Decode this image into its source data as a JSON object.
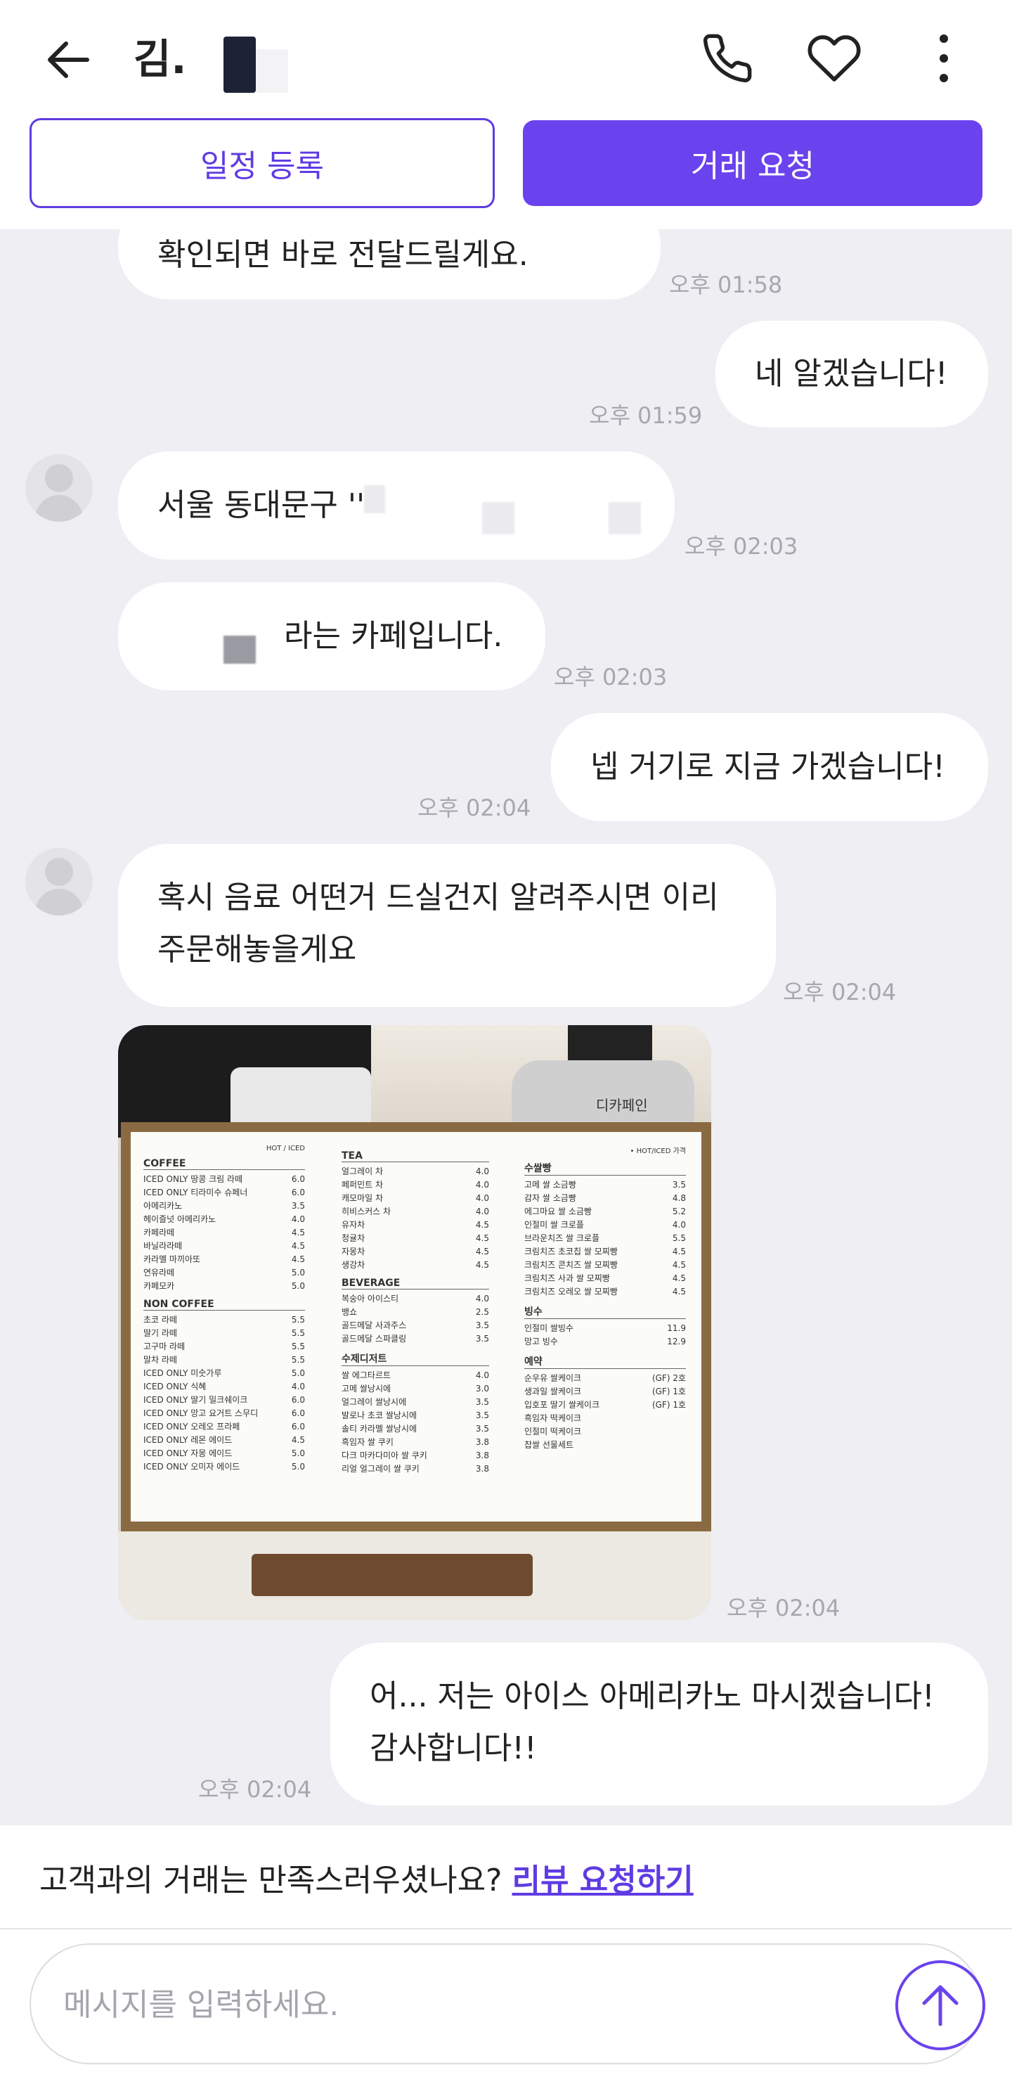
{
  "header": {
    "contact_name": "김.",
    "buttons": {
      "schedule": "일정 등록",
      "trade_request": "거래 요청"
    }
  },
  "messages": [
    {
      "side": "in",
      "lines": [
        "확인되면 바로 전달드릴게요."
      ],
      "time": "오후 01:58"
    },
    {
      "side": "out",
      "lines": [
        "네 알겠습니다!"
      ],
      "time": "오후 01:59"
    },
    {
      "side": "in",
      "lines": [
        "서울 동대문구 '' "
      ],
      "time": "오후 02:03"
    },
    {
      "side": "in",
      "lines": [
        "라는 카페입니다."
      ],
      "time": "오후 02:03"
    },
    {
      "side": "out",
      "lines": [
        "넵 거기로 지금 가겠습니다!"
      ],
      "time": "오후 02:04"
    },
    {
      "side": "in",
      "lines": [
        "혹시 음료 어떤거 드실건지 알려주시면 이리",
        "주문해놓을게요"
      ],
      "time": "오후 02:04"
    },
    {
      "side": "in",
      "type": "image",
      "time": "오후 02:04"
    },
    {
      "side": "out",
      "lines": [
        "어... 저는 아이스 아메리카노 마시겠습니다!",
        "감사합니다!!"
      ],
      "time": "오후 02:04"
    }
  ],
  "photo_menu": {
    "cafe_label": "디카페인",
    "hot_iced": "HOT / ICED",
    "coffee": {
      "title": "COFFEE",
      "items": [
        [
          "ICED ONLY 땅콩 크림 라떼",
          "6.0"
        ],
        [
          "ICED ONLY 티라미수 슈페너",
          "6.0"
        ],
        [
          "아메리카노",
          "3.5"
        ],
        [
          "헤이즐넛 아메리카노",
          "4.0"
        ],
        [
          "카페라떼",
          "4.5"
        ],
        [
          "바닐라라떼",
          "4.5"
        ],
        [
          "카라멜 마끼아또",
          "4.5"
        ],
        [
          "연유라떼",
          "5.0"
        ],
        [
          "카페모카",
          "5.0"
        ]
      ]
    },
    "noncoffee": {
      "title": "NON COFFEE",
      "items": [
        [
          "초코 라떼",
          "5.5"
        ],
        [
          "딸기 라떼",
          "5.5"
        ],
        [
          "고구마 라떼",
          "5.5"
        ],
        [
          "말차 라떼",
          "5.5"
        ],
        [
          "ICED ONLY 미숫가루",
          "5.0"
        ],
        [
          "ICED ONLY 식혜",
          "4.0"
        ],
        [
          "ICED ONLY 딸기 밀크쉐이크",
          "6.0"
        ],
        [
          "ICED ONLY 망고 요거트 스무디",
          "6.0"
        ],
        [
          "ICED ONLY 오레오 프라페",
          "6.0"
        ],
        [
          "ICED ONLY 레몬 에이드",
          "4.5"
        ],
        [
          "ICED ONLY 자몽 에이드",
          "5.0"
        ],
        [
          "ICED ONLY 오미자 에이드",
          "5.0"
        ]
      ]
    },
    "tea": {
      "title": "TEA",
      "items": [
        [
          "얼그레이 차",
          "4.0"
        ],
        [
          "페퍼민트 차",
          "4.0"
        ],
        [
          "캐모마일 차",
          "4.0"
        ],
        [
          "히비스커스 차",
          "4.0"
        ],
        [
          "유자차",
          "4.5"
        ],
        [
          "청귤차",
          "4.5"
        ],
        [
          "자몽차",
          "4.5"
        ],
        [
          "생강차",
          "4.5"
        ]
      ]
    },
    "beverage": {
      "title": "BEVERAGE",
      "items": [
        [
          "복숭아 아이스티",
          "4.0"
        ],
        [
          "뱅쇼",
          "2.5"
        ],
        [
          "골드메달 사과주스",
          "3.5"
        ],
        [
          "골드메달 스파클링",
          "3.5"
        ]
      ]
    },
    "dessert": {
      "title": "수제디저트",
      "items": [
        [
          "쌀 에그타르트",
          "4.0"
        ],
        [
          "고메 쌀낭시에",
          "3.0"
        ],
        [
          "얼그레이 쌀낭시에",
          "3.5"
        ],
        [
          "발로나 초코 쌀낭시에",
          "3.5"
        ],
        [
          "솔티 카라멜 쌀낭시에",
          "3.5"
        ],
        [
          "흑임자 쌀 쿠키",
          "3.8"
        ],
        [
          "다크 마카다미아 쌀 쿠키",
          "3.8"
        ],
        [
          "리얼 얼그레이 쌀 쿠키",
          "3.8"
        ]
      ]
    },
    "bread": {
      "title": "수쌀빵",
      "items": [
        [
          "고메 쌀 소금빵",
          "3.5"
        ],
        [
          "감자 쌀 소금빵",
          "4.8"
        ],
        [
          "에그마요 쌀 소금빵",
          "5.2"
        ],
        [
          "인절미 쌀 크로플",
          "4.0"
        ],
        [
          "브라운치즈 쌀 크로플",
          "5.5"
        ],
        [
          "크림치즈 초코칩 쌀 모찌빵",
          "4.5"
        ],
        [
          "크림치즈 콘치즈 쌀 모찌빵",
          "4.5"
        ],
        [
          "크림치즈 사과 쌀 모찌빵",
          "4.5"
        ],
        [
          "크림치즈 오레오 쌀 모찌빵",
          "4.5"
        ]
      ]
    },
    "bingsu": {
      "title": "빙수",
      "items": [
        [
          "인절미 쌀빙수",
          "11.9"
        ],
        [
          "망고 빙수",
          "12.9"
        ]
      ]
    },
    "reservation": {
      "title": "예약",
      "items": [
        [
          "순우유 쌀케이크",
          "(GF) 2호"
        ],
        [
          "생과일 쌀케이크",
          "(GF) 1호"
        ],
        [
          "입호포 딸기 쌀케이크",
          "(GF) 1호"
        ],
        [
          "흑임자 떡케이크",
          ""
        ],
        [
          "인절미 떡케이크",
          ""
        ],
        [
          "찹쌀 선물세트",
          ""
        ]
      ]
    },
    "top_right_note": "• HOT/ICED 가격"
  },
  "review": {
    "question": "고객과의 거래는 만족스러우셨나요?",
    "link": "리뷰 요청하기"
  },
  "composer": {
    "placeholder": "메시지를 입력하세요."
  },
  "colors": {
    "accent": "#6a43ee",
    "background": "#eeeef3",
    "time": "#a7a7ae"
  }
}
